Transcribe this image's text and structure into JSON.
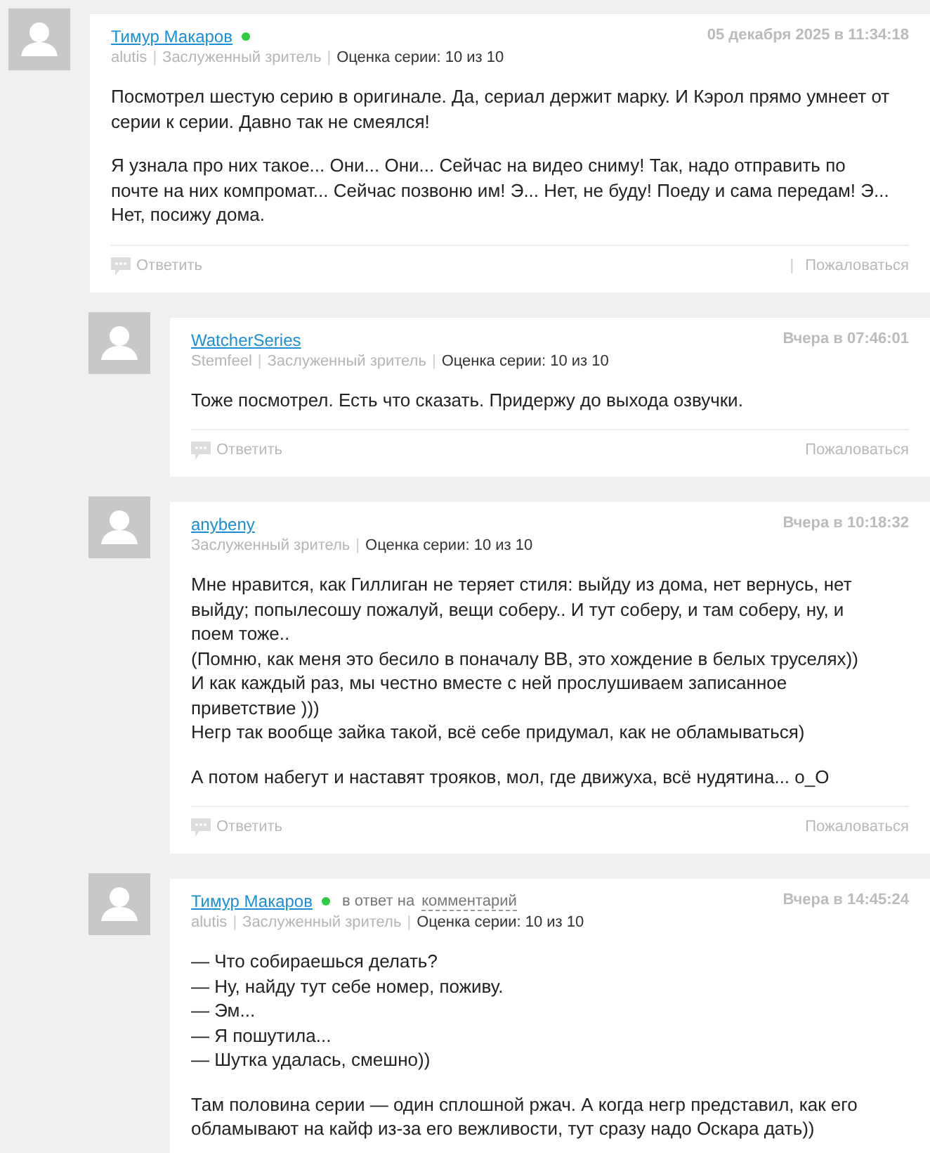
{
  "comments": [
    {
      "author": "Тимур Макаров",
      "online": true,
      "meta": [
        {
          "kind": "nick",
          "text": "alutis"
        },
        {
          "kind": "divider",
          "text": "|"
        },
        {
          "kind": "rank",
          "text": "Заслуженный зритель"
        },
        {
          "kind": "divider",
          "text": "|"
        },
        {
          "kind": "rating",
          "text": "Оценка серии: 10 из 10"
        }
      ],
      "date": "05 декабря 2025 в 11:34:18",
      "reply": false,
      "paragraphs": [
        "Посмотрел шестую серию в оригинале. Да, сериал держит марку. И Кэрол прямо умнеет от серии к серии. Давно так не смеялся!",
        "Я узнала про них такое... Они... Они... Сейчас на видео сниму! Так, надо отправить по почте на них компромат... Сейчас позвоню им! Э... Нет, не буду! Поеду и сама передам! Э... Нет, посижу дома."
      ],
      "actions": {
        "reply": "Ответить",
        "divider": "|",
        "report": "Пожаловаться"
      }
    },
    {
      "author": "WatcherSeries",
      "online": false,
      "meta": [
        {
          "kind": "nick",
          "text": "Stemfeel"
        },
        {
          "kind": "divider",
          "text": "|"
        },
        {
          "kind": "rank",
          "text": "Заслуженный зритель"
        },
        {
          "kind": "divider",
          "text": "|"
        },
        {
          "kind": "rating",
          "text": "Оценка серии: 10 из 10"
        }
      ],
      "date": "Вчера в 07:46:01",
      "reply": true,
      "paragraphs": [
        "Тоже посмотрел. Есть что сказать. Придержу до выхода озвучки."
      ],
      "actions": {
        "reply": "Ответить",
        "report": "Пожаловаться"
      }
    },
    {
      "author": "anybeny",
      "online": false,
      "meta": [
        {
          "kind": "rank",
          "text": "Заслуженный зритель"
        },
        {
          "kind": "divider",
          "text": "|"
        },
        {
          "kind": "rating",
          "text": "Оценка серии: 10 из 10"
        }
      ],
      "date": "Вчера в 10:18:32",
      "reply": true,
      "paragraphs": [
        "Мне нравится, как Гиллиган не теряет стиля: выйду из дома, нет вернусь, нет выйду; попылесошу пожалуй, вещи соберу.. И тут соберу, и там соберу, ну, и поем тоже..\n(Помню, как меня это бесило в поначалу BB, это хождение в белых труселях))\nИ как каждый раз, мы честно вместе с ней прослушиваем записанное приветствие )))\nНегр так вообще зайка такой, всё себе придумал, как не обламываться)",
        "А потом набегут и наставят трояков, мол, где движуха, всё нудятина...  о_О"
      ],
      "actions": {
        "reply": "Ответить",
        "report": "Пожаловаться"
      }
    },
    {
      "author": "Тимур Макаров",
      "online": true,
      "in_reply": {
        "prefix": "в ответ на",
        "link": "комментарий"
      },
      "meta": [
        {
          "kind": "nick",
          "text": "alutis"
        },
        {
          "kind": "divider",
          "text": "|"
        },
        {
          "kind": "rank",
          "text": "Заслуженный зритель"
        },
        {
          "kind": "divider",
          "text": "|"
        },
        {
          "kind": "rating",
          "text": "Оценка серии: 10 из 10"
        }
      ],
      "date": "Вчера в 14:45:24",
      "reply": true,
      "paragraphs": [
        "— Что собираешься делать?\n— Ну, найду тут себе номер, поживу.\n— Эм...\n— Я пошутила...\n— Шутка удалась, смешно))",
        "Там половина серии — один сплошной ржач. А когда негр представил, как его обламывают на кайф из-за его вежливости, тут сразу надо Оскара дать))"
      ]
    }
  ]
}
